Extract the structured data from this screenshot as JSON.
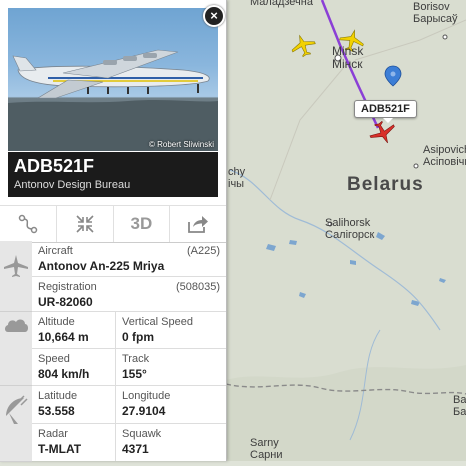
{
  "map": {
    "country_label": "Belarus",
    "cities": [
      {
        "name_lat": "Minsk",
        "name_cyr": "Мінск"
      },
      {
        "name_lat": "Borisov",
        "name_cyr": "Барысаў"
      },
      {
        "name_lat": "Salihorsk",
        "name_cyr": "Салігорск"
      },
      {
        "name_lat": "Asipovichy",
        "name_cyr": "Асіповічы"
      },
      {
        "name_lat": "Sarny",
        "name_cyr": "Сарни"
      }
    ],
    "partial_labels": {
      "top_left": "Маладзечна",
      "left_mid_1": "chy",
      "left_mid_2": "ічы",
      "right_1": "Ba",
      "right_2": "Ба"
    },
    "flight_tag": "ADB521F",
    "colors": {
      "track": "#8b3fd6",
      "aircraft_selected": "#d9302a",
      "aircraft_other": "#f2d100",
      "marker": "#3c7ed6"
    }
  },
  "panel": {
    "photo_credit": "© Robert Sliwinski",
    "flight_id": "ADB521F",
    "airline": "Antonov Design Bureau",
    "toolbar": {
      "route_icon": "route-icon",
      "collapse_icon": "collapse-icon",
      "three_d_label": "3D",
      "share_icon": "share-icon"
    },
    "aircraft": {
      "label": "Aircraft",
      "value": "Antonov An-225 Mriya",
      "code": "(A225)"
    },
    "registration": {
      "label": "Registration",
      "value": "UR-82060",
      "code": "(508035)"
    },
    "altitude": {
      "label": "Altitude",
      "value": "10,664 m"
    },
    "vertical_speed": {
      "label": "Vertical Speed",
      "value": "0 fpm"
    },
    "speed": {
      "label": "Speed",
      "value": "804 km/h"
    },
    "track": {
      "label": "Track",
      "value": "155°"
    },
    "latitude": {
      "label": "Latitude",
      "value": "53.558"
    },
    "longitude": {
      "label": "Longitude",
      "value": "27.9104"
    },
    "radar": {
      "label": "Radar",
      "value": "T-MLAT"
    },
    "squawk": {
      "label": "Squawk",
      "value": "4371"
    }
  }
}
